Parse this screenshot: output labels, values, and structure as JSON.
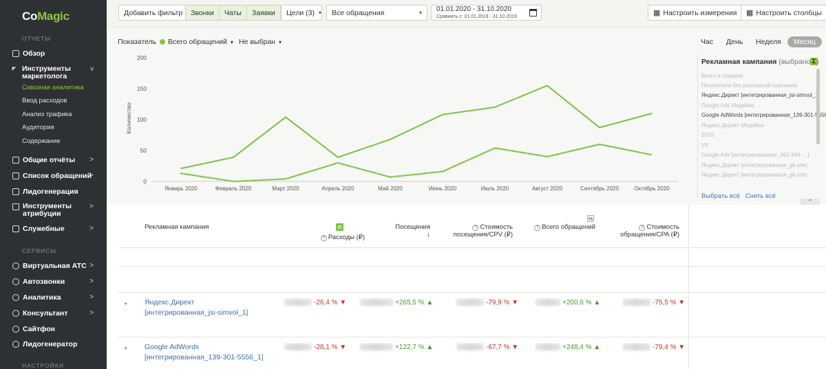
{
  "sidebar": {
    "logo": {
      "part1": "Co",
      "part2": "Magic"
    },
    "section_reports": "ОТЧЕТЫ",
    "items": [
      {
        "label": "Обзор"
      },
      {
        "label": "Инструменты маркетолога"
      },
      {
        "label": "Общие отчёты"
      },
      {
        "label": "Список обращений"
      },
      {
        "label": "Лидогенерация"
      },
      {
        "label": "Инструменты атрибуции"
      },
      {
        "label": "Служебные"
      }
    ],
    "subitems": [
      {
        "label": "Сквозная аналитика",
        "active": true
      },
      {
        "label": "Ввод расходов"
      },
      {
        "label": "Анализ трафика"
      },
      {
        "label": "Аудитория"
      },
      {
        "label": "Содержание"
      }
    ],
    "section_services": "СЕРВИСЫ",
    "services": [
      {
        "label": "Виртуальная АТС"
      },
      {
        "label": "Автозвонки"
      },
      {
        "label": "Аналитика"
      },
      {
        "label": "Консультант"
      },
      {
        "label": "Сайтфон"
      },
      {
        "label": "Лидогенератор"
      }
    ],
    "section_settings": "НАСТРОЙКИ",
    "arrow": ">",
    "chevron_down": "v"
  },
  "toolbar": {
    "add_filter": "Добавить фильтр",
    "calls": "Звонки",
    "chats": "Чаты",
    "requests": "Заявки",
    "goals": "Цели (3)",
    "appeals_select": "Все обращения",
    "date_range": "01.01.2020 - 31.10.2020",
    "compare_range": "Сравнить с: 01.01.2019 - 31.10.2019",
    "configure_measures": "Настроить измерения",
    "configure_columns": "Настроить столбцы"
  },
  "chart_controls": {
    "indicator_label": "Показатель",
    "indicator_value": "Всего обращений",
    "secondary_value": "Не выбран",
    "periods": [
      "Час",
      "День",
      "Неделя",
      "Месяц"
    ],
    "selected_period": "Месяц"
  },
  "legend_panel": {
    "title": "Рекламная кампания",
    "count": "(выбрано 2)",
    "sigma": "Σ",
    "items": [
      {
        "label": "Всего и среднее",
        "on": false
      },
      {
        "label": "Посетители без рекламной кампании",
        "on": false
      },
      {
        "label": "Яндекс.Директ [интегрированная_jsi-simvol_1]",
        "on": true
      },
      {
        "label": "Google Ads Медийка",
        "on": false
      },
      {
        "label": "Google AdWords [интегрированная_139-301-5556_1]",
        "on": true
      },
      {
        "label": "Яндекс.Директ Медийка",
        "on": false
      },
      {
        "label": "2GIS",
        "on": false
      },
      {
        "label": "VK",
        "on": false
      },
      {
        "label": "Google Ads [интегрированная_662-344-…]",
        "on": false
      },
      {
        "label": "Яндекс.Директ [интегрированная_gk-site]",
        "on": false
      },
      {
        "label": "Яндекс.Директ [интегрированная_gk-site]",
        "on": false
      }
    ],
    "select_all": "Выбрать всё",
    "clear_all": "Снять всё"
  },
  "chart_data": {
    "type": "line",
    "ylabel": "Количество",
    "ylim": [
      0,
      200
    ],
    "yticks": [
      0,
      50,
      100,
      150,
      200
    ],
    "categories": [
      "Январь 2020",
      "Февраль 2020",
      "Март 2020",
      "Апрель 2020",
      "Май 2020",
      "Июнь 2020",
      "Июль 2020",
      "Август 2020",
      "Сентябрь 2020",
      "Октябрь 2020"
    ],
    "series": [
      {
        "style": "solid",
        "color": "#7dc242",
        "values": [
          21,
          39,
          104,
          39,
          68,
          108,
          120,
          155,
          87,
          110
        ]
      },
      {
        "style": "dotted",
        "color": "#7dc242",
        "values": [
          13,
          0,
          4,
          30,
          7,
          16,
          54,
          40,
          60,
          43
        ]
      }
    ],
    "grid": false
  },
  "table": {
    "headers": {
      "campaign": "Рекламная кампания",
      "expenses": "Расходы (₽)",
      "visits": "Посещения",
      "cpv": "Стоимость посещения/CPV (₽)",
      "total_appeals": "Всего обращений",
      "cpa": "Стоимость обращения/CPA (₽)",
      "percent": "%"
    },
    "rows": [
      {
        "campaign": "Яндекс.Директ [интегрированная_jsi-simvol_1]",
        "expenses_delta": "-26,4 %",
        "visits_delta": "+265,5 %",
        "cpv_delta": "-79,9 %",
        "appeals_delta": "+200,6 %",
        "cpa_delta": "-75,5 %"
      },
      {
        "campaign": "Google AdWords [интегрированная_139-301-5556_1]",
        "expenses_delta": "-28,1 %",
        "visits_delta": "+122,7 %",
        "cpv_delta": "-67,7 %",
        "appeals_delta": "+248,4 %",
        "cpa_delta": "-79,4 %"
      }
    ]
  }
}
